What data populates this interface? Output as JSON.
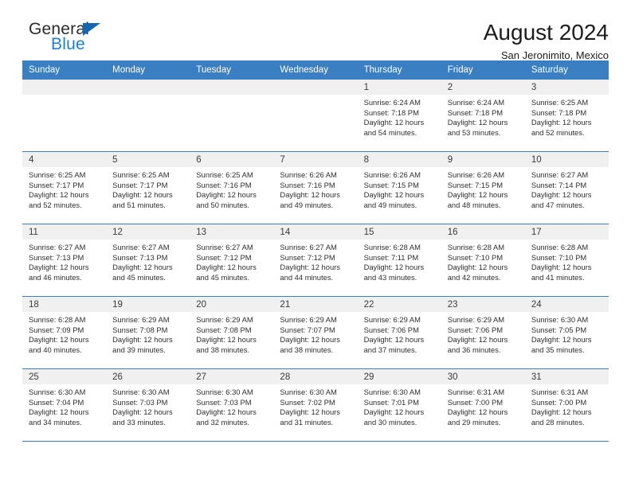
{
  "brand": {
    "name_top": "General",
    "name_bottom": "Blue",
    "flag_icon": "triangle-flag-icon",
    "accent_color": "#1c7fd6",
    "flag_color": "#1565b0"
  },
  "header": {
    "title": "August 2024",
    "subtitle": "San Jeronimito, Mexico"
  },
  "calendar": {
    "header_bg": "#3a7fc1",
    "daynum_bg": "#f0f0f0",
    "weekdays": [
      "Sunday",
      "Monday",
      "Tuesday",
      "Wednesday",
      "Thursday",
      "Friday",
      "Saturday"
    ],
    "weeks": [
      [
        {
          "day": "",
          "sunrise": "",
          "sunset": "",
          "daylight1": "",
          "daylight2": "",
          "empty": true
        },
        {
          "day": "",
          "sunrise": "",
          "sunset": "",
          "daylight1": "",
          "daylight2": "",
          "empty": true
        },
        {
          "day": "",
          "sunrise": "",
          "sunset": "",
          "daylight1": "",
          "daylight2": "",
          "empty": true
        },
        {
          "day": "",
          "sunrise": "",
          "sunset": "",
          "daylight1": "",
          "daylight2": "",
          "empty": true
        },
        {
          "day": "1",
          "sunrise": "Sunrise: 6:24 AM",
          "sunset": "Sunset: 7:18 PM",
          "daylight1": "Daylight: 12 hours",
          "daylight2": "and 54 minutes."
        },
        {
          "day": "2",
          "sunrise": "Sunrise: 6:24 AM",
          "sunset": "Sunset: 7:18 PM",
          "daylight1": "Daylight: 12 hours",
          "daylight2": "and 53 minutes."
        },
        {
          "day": "3",
          "sunrise": "Sunrise: 6:25 AM",
          "sunset": "Sunset: 7:18 PM",
          "daylight1": "Daylight: 12 hours",
          "daylight2": "and 52 minutes."
        }
      ],
      [
        {
          "day": "4",
          "sunrise": "Sunrise: 6:25 AM",
          "sunset": "Sunset: 7:17 PM",
          "daylight1": "Daylight: 12 hours",
          "daylight2": "and 52 minutes."
        },
        {
          "day": "5",
          "sunrise": "Sunrise: 6:25 AM",
          "sunset": "Sunset: 7:17 PM",
          "daylight1": "Daylight: 12 hours",
          "daylight2": "and 51 minutes."
        },
        {
          "day": "6",
          "sunrise": "Sunrise: 6:25 AM",
          "sunset": "Sunset: 7:16 PM",
          "daylight1": "Daylight: 12 hours",
          "daylight2": "and 50 minutes."
        },
        {
          "day": "7",
          "sunrise": "Sunrise: 6:26 AM",
          "sunset": "Sunset: 7:16 PM",
          "daylight1": "Daylight: 12 hours",
          "daylight2": "and 49 minutes."
        },
        {
          "day": "8",
          "sunrise": "Sunrise: 6:26 AM",
          "sunset": "Sunset: 7:15 PM",
          "daylight1": "Daylight: 12 hours",
          "daylight2": "and 49 minutes."
        },
        {
          "day": "9",
          "sunrise": "Sunrise: 6:26 AM",
          "sunset": "Sunset: 7:15 PM",
          "daylight1": "Daylight: 12 hours",
          "daylight2": "and 48 minutes."
        },
        {
          "day": "10",
          "sunrise": "Sunrise: 6:27 AM",
          "sunset": "Sunset: 7:14 PM",
          "daylight1": "Daylight: 12 hours",
          "daylight2": "and 47 minutes."
        }
      ],
      [
        {
          "day": "11",
          "sunrise": "Sunrise: 6:27 AM",
          "sunset": "Sunset: 7:13 PM",
          "daylight1": "Daylight: 12 hours",
          "daylight2": "and 46 minutes."
        },
        {
          "day": "12",
          "sunrise": "Sunrise: 6:27 AM",
          "sunset": "Sunset: 7:13 PM",
          "daylight1": "Daylight: 12 hours",
          "daylight2": "and 45 minutes."
        },
        {
          "day": "13",
          "sunrise": "Sunrise: 6:27 AM",
          "sunset": "Sunset: 7:12 PM",
          "daylight1": "Daylight: 12 hours",
          "daylight2": "and 45 minutes."
        },
        {
          "day": "14",
          "sunrise": "Sunrise: 6:27 AM",
          "sunset": "Sunset: 7:12 PM",
          "daylight1": "Daylight: 12 hours",
          "daylight2": "and 44 minutes."
        },
        {
          "day": "15",
          "sunrise": "Sunrise: 6:28 AM",
          "sunset": "Sunset: 7:11 PM",
          "daylight1": "Daylight: 12 hours",
          "daylight2": "and 43 minutes."
        },
        {
          "day": "16",
          "sunrise": "Sunrise: 6:28 AM",
          "sunset": "Sunset: 7:10 PM",
          "daylight1": "Daylight: 12 hours",
          "daylight2": "and 42 minutes."
        },
        {
          "day": "17",
          "sunrise": "Sunrise: 6:28 AM",
          "sunset": "Sunset: 7:10 PM",
          "daylight1": "Daylight: 12 hours",
          "daylight2": "and 41 minutes."
        }
      ],
      [
        {
          "day": "18",
          "sunrise": "Sunrise: 6:28 AM",
          "sunset": "Sunset: 7:09 PM",
          "daylight1": "Daylight: 12 hours",
          "daylight2": "and 40 minutes."
        },
        {
          "day": "19",
          "sunrise": "Sunrise: 6:29 AM",
          "sunset": "Sunset: 7:08 PM",
          "daylight1": "Daylight: 12 hours",
          "daylight2": "and 39 minutes."
        },
        {
          "day": "20",
          "sunrise": "Sunrise: 6:29 AM",
          "sunset": "Sunset: 7:08 PM",
          "daylight1": "Daylight: 12 hours",
          "daylight2": "and 38 minutes."
        },
        {
          "day": "21",
          "sunrise": "Sunrise: 6:29 AM",
          "sunset": "Sunset: 7:07 PM",
          "daylight1": "Daylight: 12 hours",
          "daylight2": "and 38 minutes."
        },
        {
          "day": "22",
          "sunrise": "Sunrise: 6:29 AM",
          "sunset": "Sunset: 7:06 PM",
          "daylight1": "Daylight: 12 hours",
          "daylight2": "and 37 minutes."
        },
        {
          "day": "23",
          "sunrise": "Sunrise: 6:29 AM",
          "sunset": "Sunset: 7:06 PM",
          "daylight1": "Daylight: 12 hours",
          "daylight2": "and 36 minutes."
        },
        {
          "day": "24",
          "sunrise": "Sunrise: 6:30 AM",
          "sunset": "Sunset: 7:05 PM",
          "daylight1": "Daylight: 12 hours",
          "daylight2": "and 35 minutes."
        }
      ],
      [
        {
          "day": "25",
          "sunrise": "Sunrise: 6:30 AM",
          "sunset": "Sunset: 7:04 PM",
          "daylight1": "Daylight: 12 hours",
          "daylight2": "and 34 minutes."
        },
        {
          "day": "26",
          "sunrise": "Sunrise: 6:30 AM",
          "sunset": "Sunset: 7:03 PM",
          "daylight1": "Daylight: 12 hours",
          "daylight2": "and 33 minutes."
        },
        {
          "day": "27",
          "sunrise": "Sunrise: 6:30 AM",
          "sunset": "Sunset: 7:03 PM",
          "daylight1": "Daylight: 12 hours",
          "daylight2": "and 32 minutes."
        },
        {
          "day": "28",
          "sunrise": "Sunrise: 6:30 AM",
          "sunset": "Sunset: 7:02 PM",
          "daylight1": "Daylight: 12 hours",
          "daylight2": "and 31 minutes."
        },
        {
          "day": "29",
          "sunrise": "Sunrise: 6:30 AM",
          "sunset": "Sunset: 7:01 PM",
          "daylight1": "Daylight: 12 hours",
          "daylight2": "and 30 minutes."
        },
        {
          "day": "30",
          "sunrise": "Sunrise: 6:31 AM",
          "sunset": "Sunset: 7:00 PM",
          "daylight1": "Daylight: 12 hours",
          "daylight2": "and 29 minutes."
        },
        {
          "day": "31",
          "sunrise": "Sunrise: 6:31 AM",
          "sunset": "Sunset: 7:00 PM",
          "daylight1": "Daylight: 12 hours",
          "daylight2": "and 28 minutes."
        }
      ]
    ]
  }
}
